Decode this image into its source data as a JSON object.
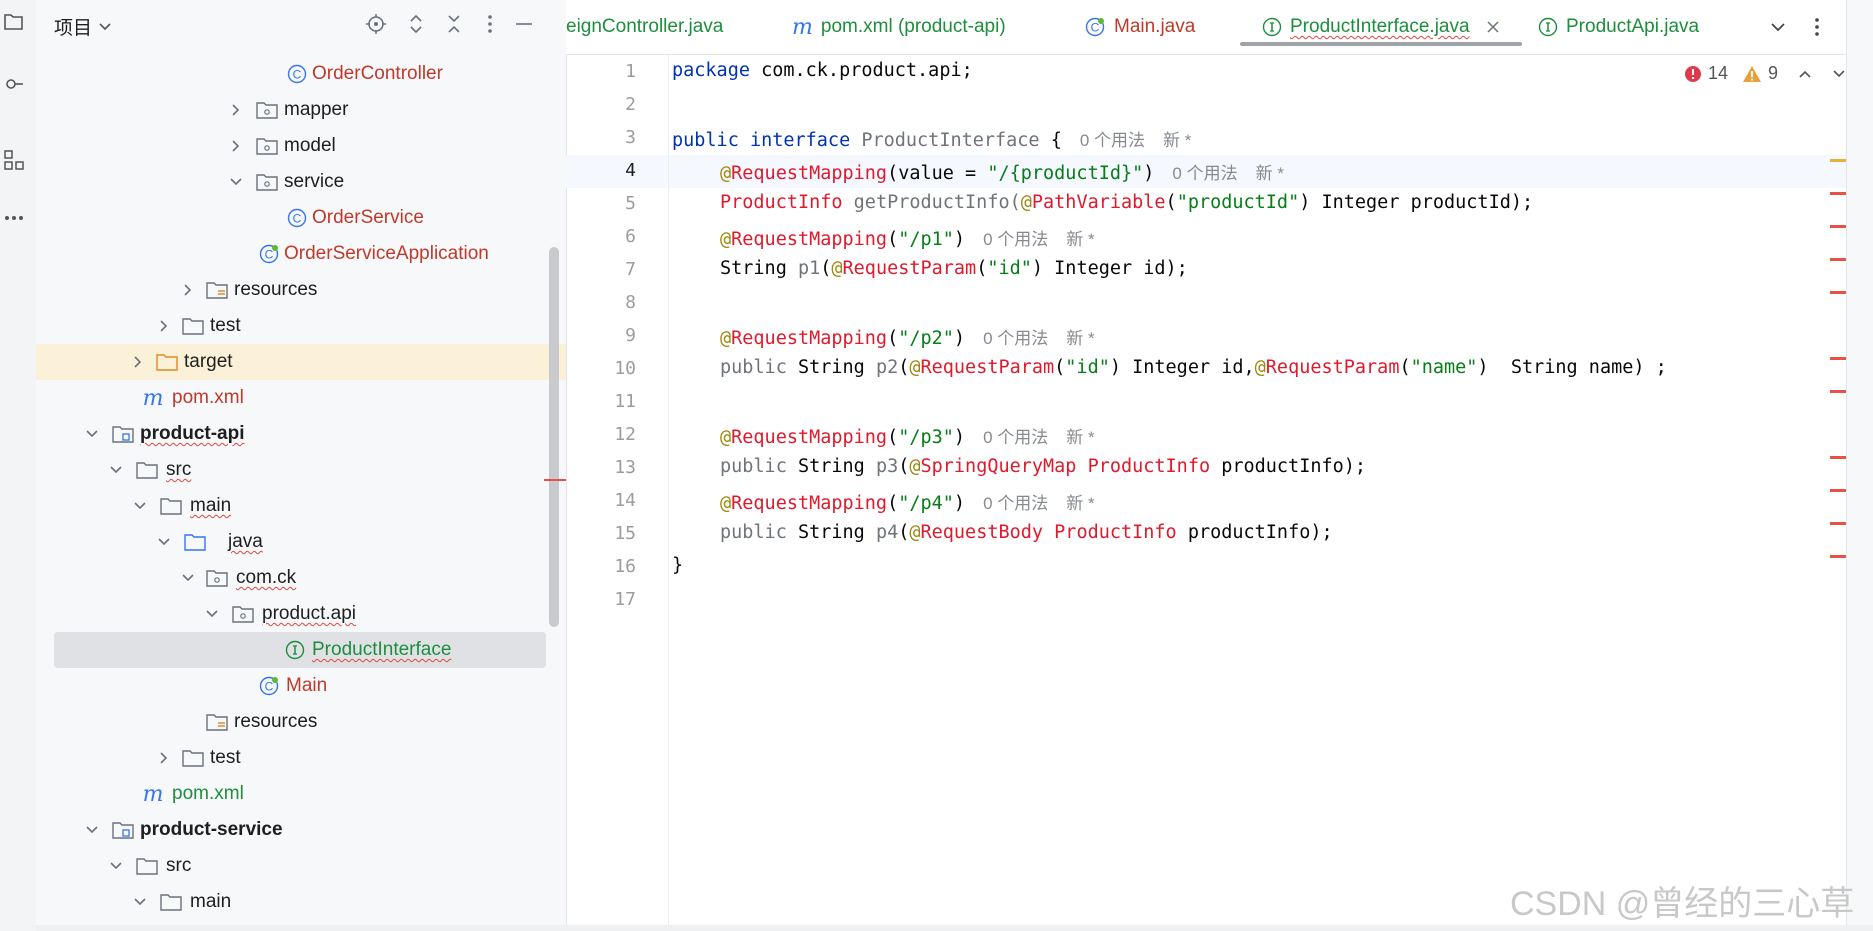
{
  "project_panel": {
    "title": "项目",
    "tree": [
      {
        "label": "OrderController",
        "kind": "class",
        "color": "red"
      },
      {
        "label": "mapper",
        "kind": "package",
        "expanded": false
      },
      {
        "label": "model",
        "kind": "package",
        "expanded": false
      },
      {
        "label": "service",
        "kind": "package",
        "expanded": true
      },
      {
        "label": "OrderService",
        "kind": "class",
        "color": "red"
      },
      {
        "label": "OrderServiceApplication",
        "kind": "spring-boot-class",
        "color": "red"
      },
      {
        "label": "resources",
        "kind": "resources-folder",
        "expanded": false
      },
      {
        "label": "test",
        "kind": "folder",
        "expanded": false
      },
      {
        "label": "target",
        "kind": "excluded-folder",
        "expanded": false
      },
      {
        "label": "pom.xml",
        "kind": "maven-file",
        "color": "red"
      },
      {
        "label": "product-api",
        "kind": "module",
        "expanded": true
      },
      {
        "label": "src",
        "kind": "folder",
        "expanded": true
      },
      {
        "label": "main",
        "kind": "folder",
        "expanded": true
      },
      {
        "label": "java",
        "kind": "source-root",
        "expanded": true
      },
      {
        "label": "com.ck",
        "kind": "package",
        "expanded": true
      },
      {
        "label": "product.api",
        "kind": "package",
        "expanded": true
      },
      {
        "label": "ProductInterface",
        "kind": "interface",
        "color": "green",
        "selected": true
      },
      {
        "label": "Main",
        "kind": "spring-boot-class",
        "color": "red"
      },
      {
        "label": "resources",
        "kind": "resources-folder"
      },
      {
        "label": "test",
        "kind": "folder",
        "expanded": false
      },
      {
        "label": "pom.xml",
        "kind": "maven-file",
        "color": "green"
      },
      {
        "label": "product-service",
        "kind": "module",
        "expanded": true
      },
      {
        "label": "src",
        "kind": "folder",
        "expanded": true
      },
      {
        "label": "main",
        "kind": "folder",
        "expanded": true
      }
    ]
  },
  "tabs": [
    {
      "label": "eignController.java",
      "color": "green",
      "icon": "none"
    },
    {
      "label": "pom.xml (product-api)",
      "color": "green",
      "icon": "maven-icon"
    },
    {
      "label": "Main.java",
      "color": "red",
      "icon": "spring-class-icon"
    },
    {
      "label": "ProductInterface.java",
      "color": "green",
      "icon": "interface-icon",
      "active": true
    },
    {
      "label": "ProductApi.java",
      "color": "green",
      "icon": "interface-icon"
    }
  ],
  "inspections": {
    "errors": "14",
    "warnings": "9"
  },
  "editor": {
    "line_numbers": [
      "1",
      "2",
      "3",
      "4",
      "5",
      "6",
      "7",
      "8",
      "9",
      "10",
      "11",
      "12",
      "13",
      "14",
      "15",
      "16",
      "17"
    ],
    "current_line": "4",
    "usage_hint": "0 个用法",
    "new_hint": "新 *",
    "lines": {
      "l1_kw": "package",
      "l1_rest": " com.ck.product.api;",
      "l3_kw1": "public",
      "l3_kw2": "interface",
      "l3_name": "ProductInterface",
      "l3_brace": " {",
      "l4_at": "@",
      "l4_ann": "RequestMapping",
      "l4_mid": "(value = ",
      "l4_str": "\"/{productId}\"",
      "l4_end": ")",
      "l5_type": "ProductInfo",
      "l5_name": " getProductInfo(",
      "l5_at": "@",
      "l5_ann": "PathVariable",
      "l5_open": "(",
      "l5_str": "\"productId\"",
      "l5_rest": ") Integer productId);",
      "l6_at": "@",
      "l6_ann": "RequestMapping",
      "l6_open": "(",
      "l6_str": "\"/p1\"",
      "l6_close": ")",
      "l7_type": "String ",
      "l7_name": "p1",
      "l7_open": "(",
      "l7_at": "@",
      "l7_ann": "RequestParam",
      "l7_p": "(",
      "l7_str": "\"id\"",
      "l7_rest": ") Integer id);",
      "l9_at": "@",
      "l9_ann": "RequestMapping",
      "l9_open": "(",
      "l9_str": "\"/p2\"",
      "l9_close": ")",
      "l10_pub": "public",
      "l10_type": " String ",
      "l10_name": "p2",
      "l10_open": "(",
      "l10_at1": "@",
      "l10_ann1": "RequestParam",
      "l10_p1": "(",
      "l10_str1": "\"id\"",
      "l10_mid": ") Integer id,",
      "l10_at2": "@",
      "l10_ann2": "RequestParam",
      "l10_p2": "(",
      "l10_str2": "\"name\"",
      "l10_rest": ")  String name) ;",
      "l12_at": "@",
      "l12_ann": "RequestMapping",
      "l12_open": "(",
      "l12_str": "\"/p3\"",
      "l12_close": ")",
      "l13_pub": "public",
      "l13_type": " String ",
      "l13_name": "p3",
      "l13_open": "(",
      "l13_at": "@",
      "l13_ann": "SpringQueryMap",
      "l13_cls": " ProductInfo",
      "l13_rest": " productInfo);",
      "l14_at": "@",
      "l14_ann": "RequestMapping",
      "l14_open": "(",
      "l14_str": "\"/p4\"",
      "l14_close": ")",
      "l15_pub": "public",
      "l15_type": " String ",
      "l15_name": "p4",
      "l15_open": "(",
      "l15_at": "@",
      "l15_ann": "RequestBody",
      "l15_cls": " ProductInfo",
      "l15_rest": " productInfo);",
      "l16": "}"
    }
  },
  "watermark": "CSDN @曾经的三心草"
}
